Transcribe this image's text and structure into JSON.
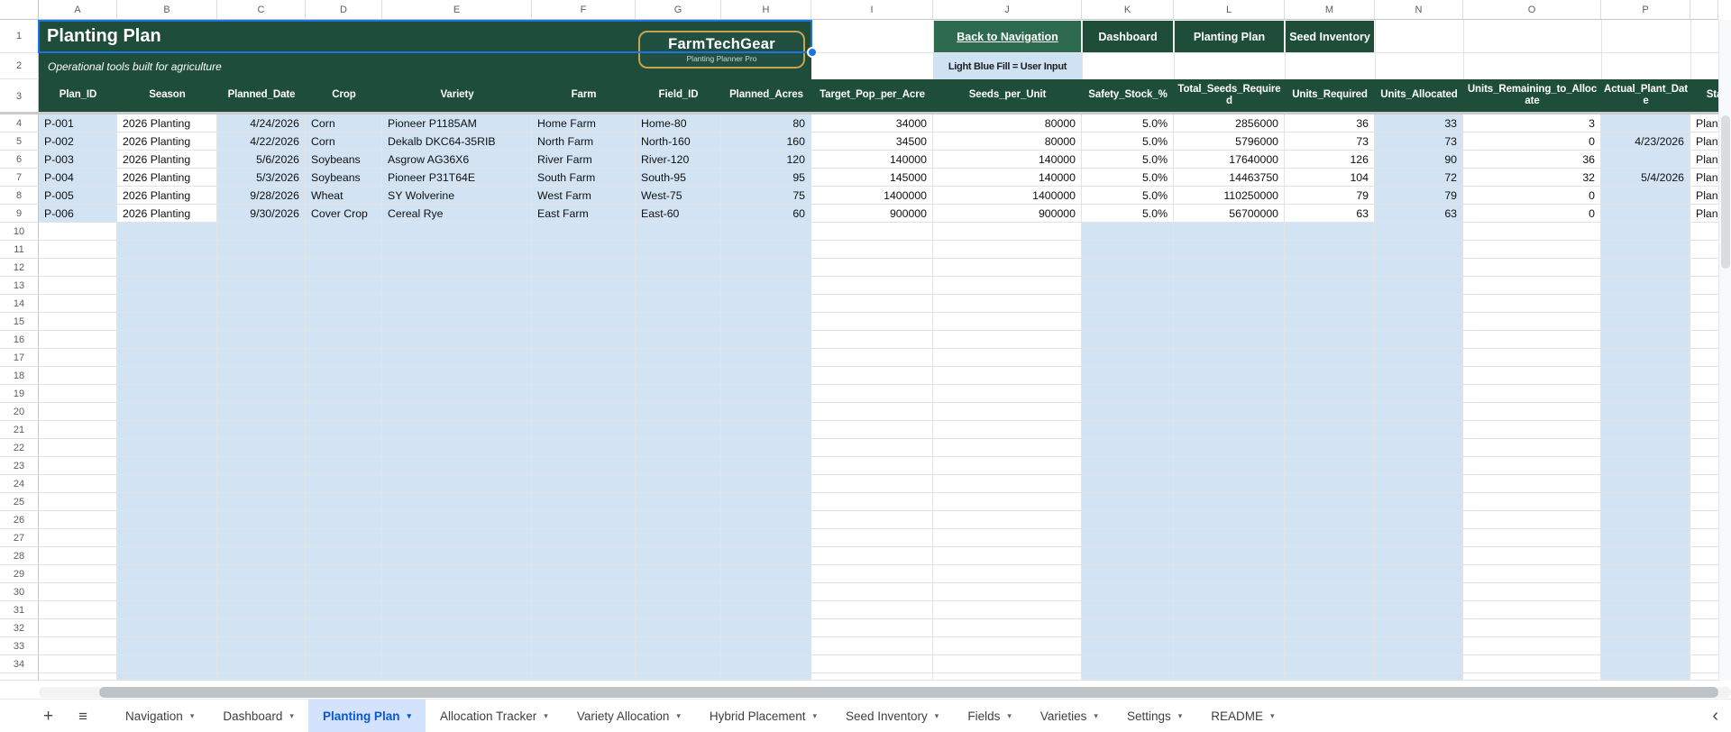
{
  "title_block": {
    "title": "Planting Plan",
    "subtitle": "Operational tools built for agriculture"
  },
  "logo": {
    "name": "FarmTechGear",
    "tagline": "Planting Planner Pro"
  },
  "nav_buttons": [
    {
      "label": "Back to Navigation"
    },
    {
      "label": "Dashboard"
    },
    {
      "label": "Planting Plan"
    },
    {
      "label": "Seed Inventory"
    }
  ],
  "legend_note": "Light Blue Fill = User Input",
  "grid": {
    "column_letters": [
      "A",
      "B",
      "C",
      "D",
      "E",
      "F",
      "G",
      "H",
      "I",
      "J",
      "K",
      "L",
      "M",
      "N",
      "O",
      "P"
    ],
    "headers": [
      "Plan_ID",
      "Season",
      "Planned_Date",
      "Crop",
      "Variety",
      "Farm",
      "Field_ID",
      "Planned_Acres",
      "Target_Pop_per_Acre",
      "Seeds_per_Unit",
      "Safety_Stock_%",
      "Total_Seeds_Required",
      "Units_Required",
      "Units_Allocated",
      "Units_Remaining_to_Allocate",
      "Actual_Plant_Date",
      "Status"
    ],
    "rows": [
      {
        "number": "4",
        "cells": [
          "P-001",
          "2026 Planting",
          "4/24/2026",
          "Corn",
          "Pioneer P1185AM",
          "Home Farm",
          "Home-80",
          "80",
          "34000",
          "80000",
          "5.0%",
          "2856000",
          "36",
          "33",
          "3",
          "",
          "Planned"
        ]
      },
      {
        "number": "5",
        "cells": [
          "P-002",
          "2026 Planting",
          "4/22/2026",
          "Corn",
          "Dekalb DKC64-35RIB",
          "North Farm",
          "North-160",
          "160",
          "34500",
          "80000",
          "5.0%",
          "5796000",
          "73",
          "73",
          "0",
          "4/23/2026",
          "Planted"
        ]
      },
      {
        "number": "6",
        "cells": [
          "P-003",
          "2026 Planting",
          "5/6/2026",
          "Soybeans",
          "Asgrow AG36X6",
          "River Farm",
          "River-120",
          "120",
          "140000",
          "140000",
          "5.0%",
          "17640000",
          "126",
          "90",
          "36",
          "",
          "Planned"
        ]
      },
      {
        "number": "7",
        "cells": [
          "P-004",
          "2026 Planting",
          "5/3/2026",
          "Soybeans",
          "Pioneer P31T64E",
          "South Farm",
          "South-95",
          "95",
          "145000",
          "140000",
          "5.0%",
          "14463750",
          "104",
          "72",
          "32",
          "5/4/2026",
          "Planted"
        ]
      },
      {
        "number": "8",
        "cells": [
          "P-005",
          "2026 Planting",
          "9/28/2026",
          "Wheat",
          "SY Wolverine",
          "West Farm",
          "West-75",
          "75",
          "1400000",
          "1400000",
          "5.0%",
          "110250000",
          "79",
          "79",
          "0",
          "",
          "Planned"
        ]
      },
      {
        "number": "9",
        "cells": [
          "P-006",
          "2026 Planting",
          "9/30/2026",
          "Cover Crop",
          "Cereal Rye",
          "East Farm",
          "East-60",
          "60",
          "900000",
          "900000",
          "5.0%",
          "56700000",
          "63",
          "63",
          "0",
          "",
          "Planned"
        ]
      }
    ],
    "first_row_number": 1,
    "last_row_number": 34
  },
  "sheet_tabs": {
    "add_icon": "+",
    "all_sheets_icon": "≡",
    "scroll_left_icon": "‹",
    "dropdown_icon": "▾",
    "active": "Planting Plan",
    "tabs": [
      "Navigation",
      "Dashboard",
      "Planting Plan",
      "Allocation Tracker",
      "Variety Allocation",
      "Hybrid Placement",
      "Seed Inventory",
      "Fields",
      "Varieties",
      "Settings",
      "README"
    ]
  },
  "colors": {
    "dark_green": "#1e4e3a",
    "button_green": "#2d6a4f",
    "input_blue": "#d2e4f4",
    "note_blue": "#cfe2f3",
    "selection_blue": "#1a73e8",
    "gold_border": "#c8a44f",
    "active_tab_bg": "#d3e3fd",
    "active_tab_text": "#0b57d0"
  }
}
